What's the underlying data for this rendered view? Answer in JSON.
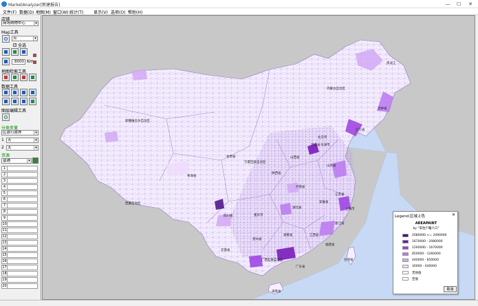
{
  "window": {
    "title": "MarketAnalyzer[新建报告]",
    "min": "—",
    "max": "☐",
    "close": "✕"
  },
  "menu": [
    "文件(F)",
    "数据(D)",
    "地图(M)",
    "窗口(W)",
    "统计(T)",
    "显示(V)",
    "选项(O)",
    "帮助(H)"
  ],
  "panel": {
    "section_area": "店铺",
    "area_combo": "商场购物中心",
    "section_map_tools": "Map工具",
    "map_tool_combo": "点",
    "select_all_label": "全选",
    "distance_value": "8000",
    "distance_unit": "Km",
    "section_map_search": "地图检索工具",
    "section_data_tools": "数据工具",
    "section_layer_edit": "图层编辑工具",
    "section_thematic": "分类变量",
    "thematic_combo": "区县行政界",
    "var1_index": "1",
    "var1_value": "无",
    "var2_index": "2",
    "var2_value": "无",
    "section_resources": "资源",
    "resource_combo": "普通",
    "rows": [
      "1",
      "2",
      "3",
      "4",
      "5",
      "6",
      "7",
      "8",
      "9",
      "10",
      "11",
      "12",
      "13",
      "14",
      "15",
      "16",
      "17",
      "18",
      "19",
      "20"
    ]
  },
  "map_labels": {
    "heilongjiang": "黑龙江",
    "neimenggu": "内蒙古自治区",
    "jilin": "吉林省",
    "liaoning": "辽宁省",
    "xinjiang": "新疆维吾尔自治区",
    "beijing": "北京市",
    "tianjin": "天津市",
    "hebei": "河北省",
    "gansu": "甘肃省",
    "ningxia": "宁夏回族自治区",
    "shanxi": "山西省",
    "shandong": "山东省",
    "qinghai": "青海省",
    "shaanxi": "陕西省",
    "henan": "河南省",
    "jiangsu": "江苏省",
    "xizang": "西藏自治区",
    "hubei": "湖北省",
    "anhui": "安徽省",
    "shanghai": "上海市",
    "sichuan": "四川省",
    "chongqing": "重庆市",
    "zhejiang": "浙江省",
    "guizhou": "贵州省",
    "hunan": "湖南省",
    "jiangxi": "江西省",
    "fujian": "福建省",
    "yunnan": "云南省",
    "guangxi": "广西壮族自治区",
    "guangdong": "广东省",
    "taiwan": "台湾省",
    "hainan": "海南省"
  },
  "legend": {
    "title": "Legend:区域上色",
    "close": "✕",
    "header": "AREAPAINT",
    "subtitle": "by \"常住户籍人口\"",
    "cancel": "取消",
    "items": [
      {
        "range": "2080000 <= 2490000",
        "color": "#4a0a82"
      },
      {
        "range": "1670000 - 2080000",
        "color": "#7412b8"
      },
      {
        "range": "1260000 - 1670000",
        "color": "#9a3ee0"
      },
      {
        "range": "850000 - 1260000",
        "color": "#b978ee"
      },
      {
        "range": "440000 - 850000",
        "color": "#d2a8f5"
      },
      {
        "range": "30000 - 440000",
        "color": "#eedcfb"
      },
      {
        "range": "无效值",
        "color": "#ffffff"
      },
      {
        "range": "空值",
        "color": "#ffffff"
      }
    ]
  },
  "colors": {
    "sea": "#c7d9f5",
    "land_bg": "#f5efff",
    "border": "#b89fd9",
    "frame_bg": "#c8c8c8"
  }
}
